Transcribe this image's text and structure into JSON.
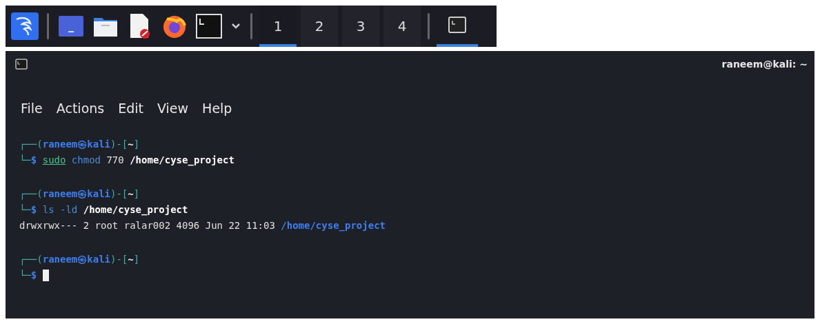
{
  "taskbar": {
    "launchers": [
      {
        "kind": "kali"
      },
      {
        "kind": "desktop"
      },
      {
        "kind": "files"
      },
      {
        "kind": "editor"
      },
      {
        "kind": "firefox"
      },
      {
        "kind": "terminal"
      },
      {
        "kind": "dropdown"
      }
    ],
    "workspaces": [
      {
        "label": "1",
        "selected": true
      },
      {
        "label": "2",
        "selected": false
      },
      {
        "label": "3",
        "selected": false
      },
      {
        "label": "4",
        "selected": false
      }
    ],
    "tasks": [
      {
        "kind": "terminal",
        "selected": true
      }
    ]
  },
  "window": {
    "title": "raneem@kali: ~"
  },
  "menu": [
    "File",
    "Actions",
    "Edit",
    "View",
    "Help"
  ],
  "terminal": {
    "lines": [
      {
        "kind": "prompt",
        "tokens": [
          {
            "text": "┌──(",
            "kind": "frame"
          },
          {
            "text": "raneem㉿kali",
            "kind": "user"
          },
          {
            "text": ")-[",
            "kind": "frame"
          },
          {
            "text": "~",
            "kind": "dir"
          },
          {
            "text": "]",
            "kind": "frame"
          }
        ]
      },
      {
        "kind": "command",
        "tokens": [
          {
            "text": "└─",
            "kind": "frame"
          },
          {
            "text": "$ ",
            "kind": "user"
          },
          {
            "text": "sudo",
            "kind": "precommand"
          },
          {
            "text": " chmod",
            "kind": "command"
          },
          {
            "text": " 770",
            "kind": "plain"
          },
          {
            "text": " /home/cyse_project",
            "kind": "path"
          }
        ]
      },
      {
        "kind": "blank"
      },
      {
        "kind": "prompt",
        "tokens": [
          {
            "text": "┌──(",
            "kind": "frame"
          },
          {
            "text": "raneem㉿kali",
            "kind": "user"
          },
          {
            "text": ")-[",
            "kind": "frame"
          },
          {
            "text": "~",
            "kind": "dir"
          },
          {
            "text": "]",
            "kind": "frame"
          }
        ]
      },
      {
        "kind": "command",
        "tokens": [
          {
            "text": "└─",
            "kind": "frame"
          },
          {
            "text": "$ ",
            "kind": "user"
          },
          {
            "text": "ls -ld",
            "kind": "command"
          },
          {
            "text": " /home/cyse_project",
            "kind": "path"
          }
        ]
      },
      {
        "kind": "output",
        "tokens": [
          {
            "text": "drwxrwx--- 2 root ralar002 4096 Jun 22 11:03 ",
            "kind": "plain"
          },
          {
            "text": "/home/cyse_project",
            "kind": "directory"
          }
        ]
      },
      {
        "kind": "blank"
      },
      {
        "kind": "prompt",
        "tokens": [
          {
            "text": "┌──(",
            "kind": "frame"
          },
          {
            "text": "raneem㉿kali",
            "kind": "user"
          },
          {
            "text": ")-[",
            "kind": "frame"
          },
          {
            "text": "~",
            "kind": "dir"
          },
          {
            "text": "]",
            "kind": "frame"
          }
        ]
      },
      {
        "kind": "command",
        "cursor": true,
        "tokens": [
          {
            "text": "└─",
            "kind": "frame"
          },
          {
            "text": "$ ",
            "kind": "user"
          }
        ]
      }
    ]
  }
}
